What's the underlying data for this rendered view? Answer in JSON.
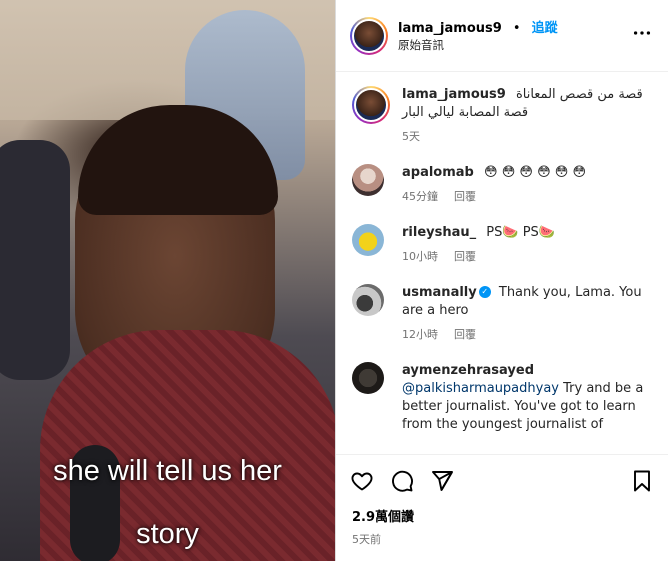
{
  "video": {
    "caption_line1": "she will tell us her",
    "caption_line2": "story"
  },
  "header": {
    "username": "lama_jamous9",
    "separator": "•",
    "follow_label": "追蹤",
    "audio_label": "原始音訊",
    "more_icon": "more-horizontal-icon"
  },
  "post": {
    "username": "lama_jamous9",
    "text": "قصة من قصص المعاناة قصة المصابة ليالي البار",
    "time": "5天"
  },
  "comments": [
    {
      "username": "apalomab",
      "text": "😳 😳 😳 😳 😳 😳",
      "time": "45分鐘",
      "reply": "回覆"
    },
    {
      "username": "rileyshau_",
      "text": "PS🍉 PS🍉",
      "time": "10小時",
      "reply": "回覆"
    },
    {
      "username": "usmanally",
      "verified": true,
      "text": "Thank you, Lama. You are a hero",
      "time": "12小時",
      "reply": "回覆"
    },
    {
      "username": "aymenzehrasayed",
      "mention": "@palkisharmaupadhyay",
      "text": "Try and be a better journalist. You've got to learn from the youngest journalist of"
    }
  ],
  "footer": {
    "views": "2.9萬個讚",
    "time": "5天前"
  },
  "colors": {
    "accent": "#0095f6",
    "mention": "#00376b",
    "muted": "#737373"
  }
}
